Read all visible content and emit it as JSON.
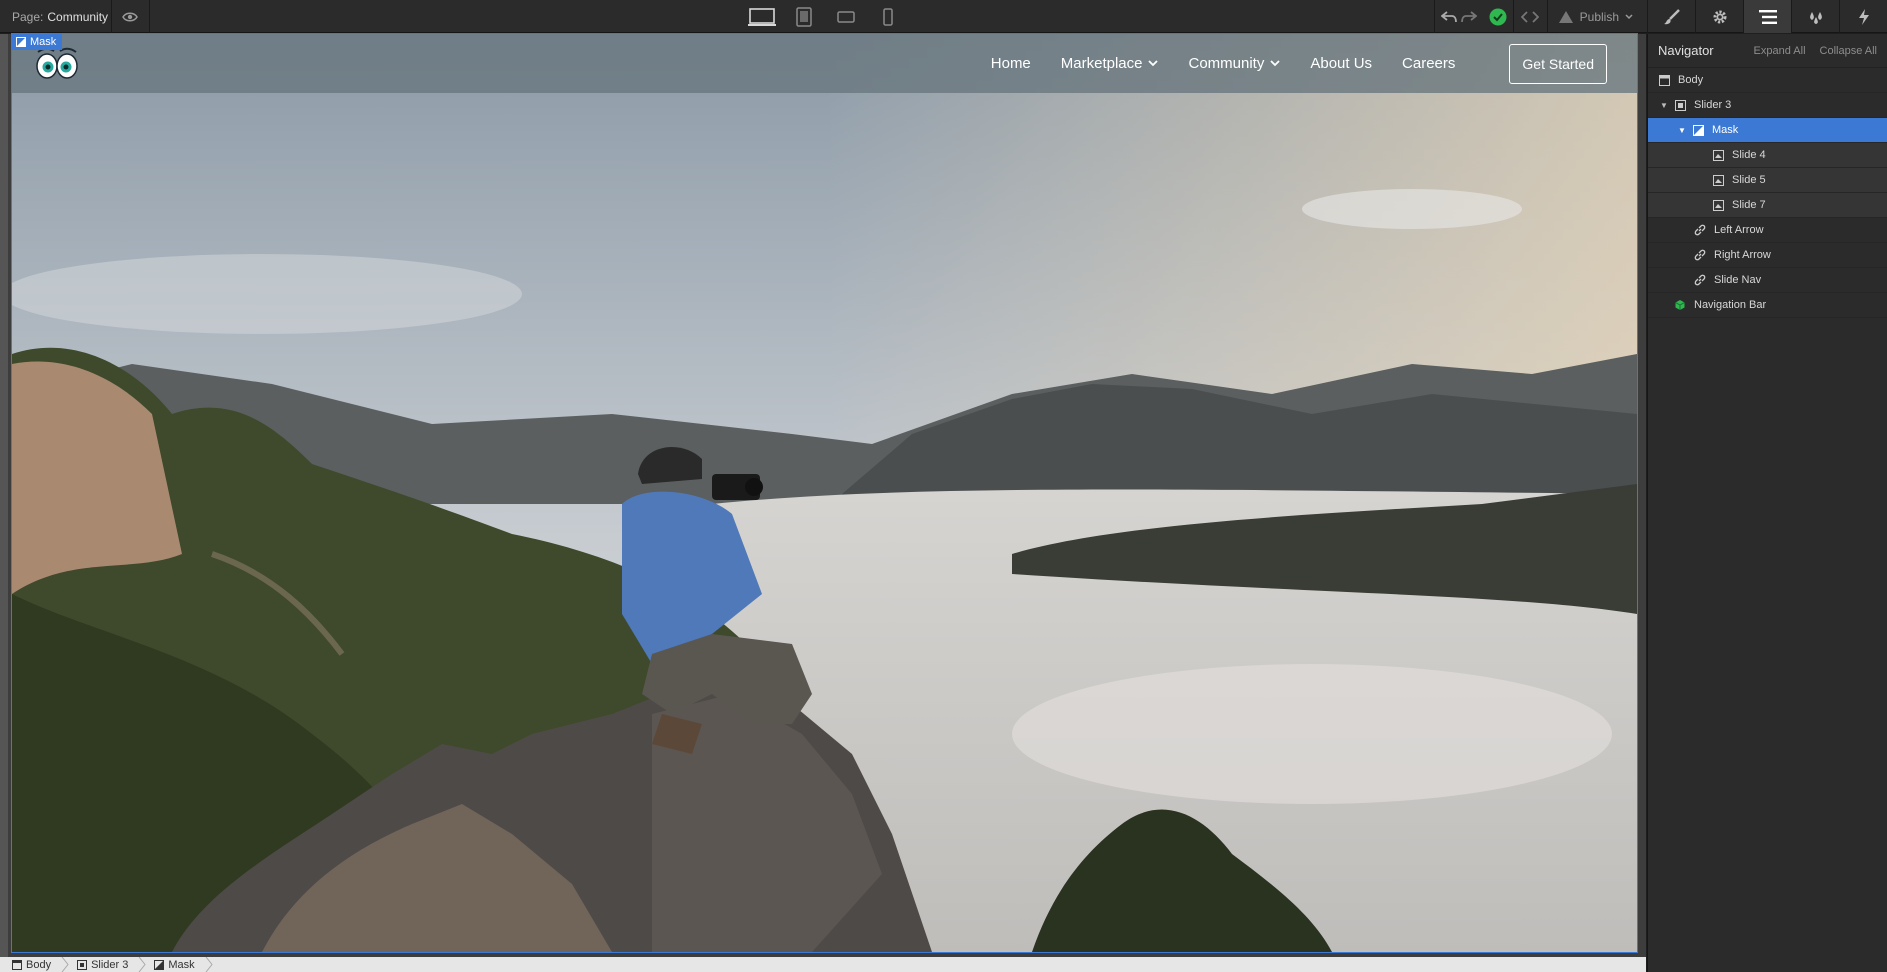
{
  "topbar": {
    "page_label": "Page:",
    "page_name": "Community",
    "publish_label": "Publish"
  },
  "site": {
    "nav": {
      "home": "Home",
      "marketplace": "Marketplace",
      "community": "Community",
      "about": "About Us",
      "careers": "Careers",
      "cta": "Get Started"
    },
    "selection_tag": "Mask"
  },
  "breadcrumb": [
    "Body",
    "Slider 3",
    "Mask"
  ],
  "navigator": {
    "title": "Navigator",
    "expand_all": "Expand All",
    "collapse_all": "Collapse All",
    "items": [
      {
        "label": "Body"
      },
      {
        "label": "Slider 3"
      },
      {
        "label": "Mask"
      },
      {
        "label": "Slide 4"
      },
      {
        "label": "Slide 5"
      },
      {
        "label": "Slide 7"
      },
      {
        "label": "Left Arrow"
      },
      {
        "label": "Right Arrow"
      },
      {
        "label": "Slide Nav"
      },
      {
        "label": "Navigation Bar"
      }
    ]
  },
  "colors": {
    "selection": "#3b79d4",
    "status_ok": "#2fb84f",
    "toolbar": "#2b2b2b"
  }
}
